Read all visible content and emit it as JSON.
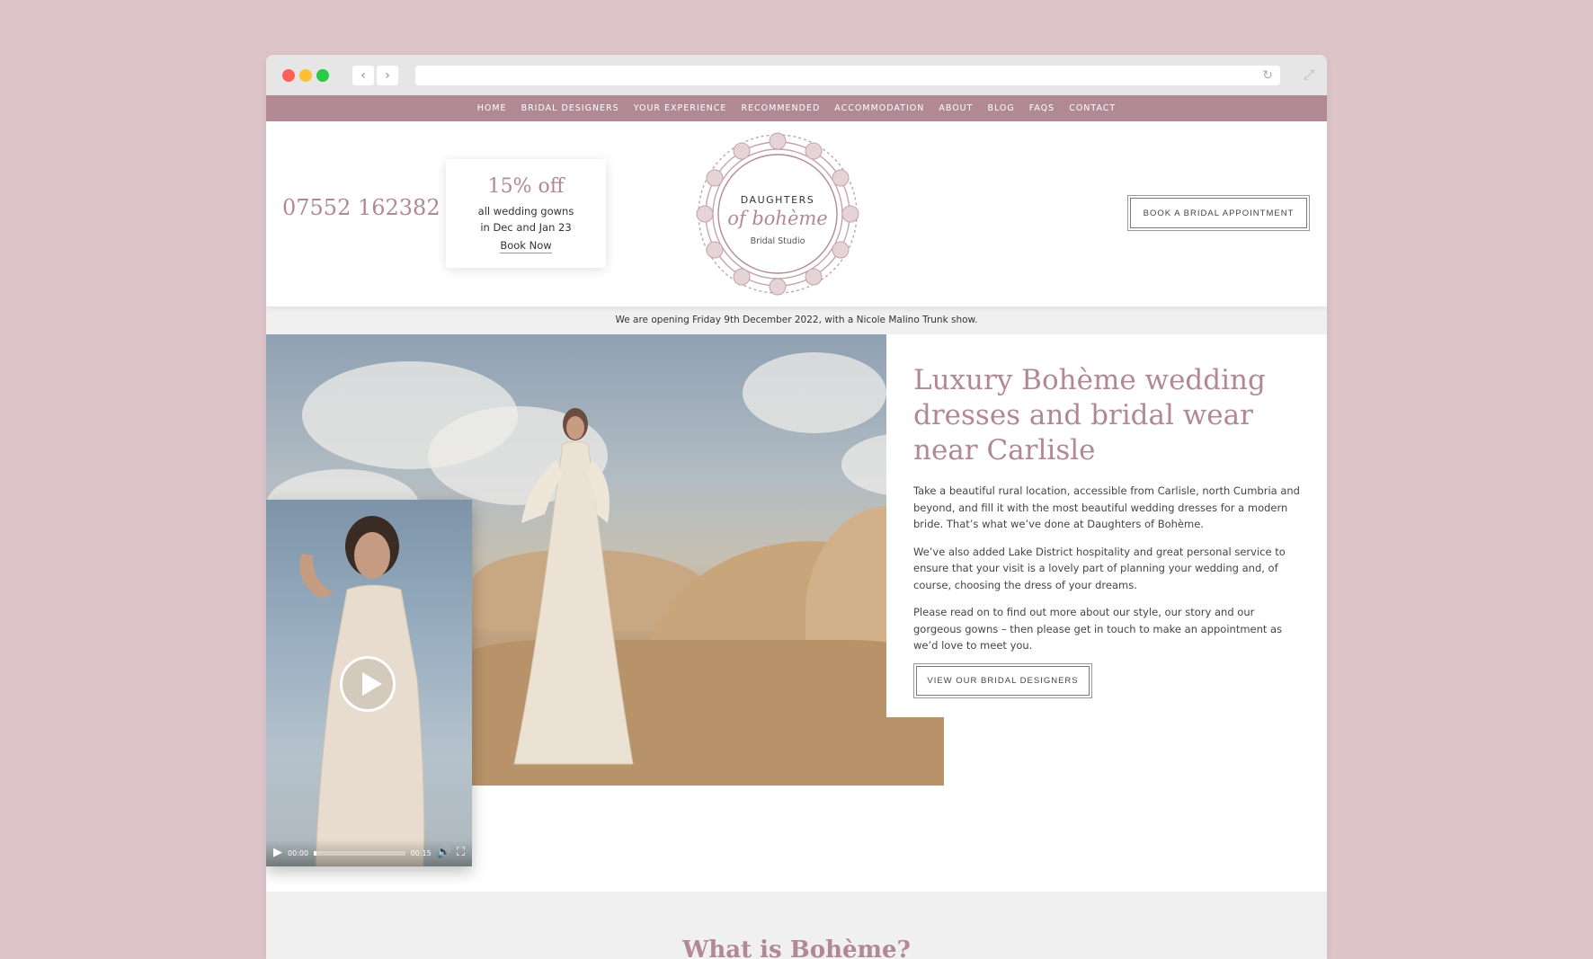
{
  "browser": {
    "back_icon": "chevron-left-icon",
    "forward_icon": "chevron-right-icon",
    "reload_icon": "reload-icon",
    "expand_icon": "expand-icon",
    "url": ""
  },
  "nav": {
    "items": [
      "HOME",
      "BRIDAL DESIGNERS",
      "YOUR EXPERIENCE",
      "RECOMMENDED",
      "ACCOMMODATION",
      "ABOUT",
      "BLOG",
      "FAQS",
      "CONTACT"
    ]
  },
  "header": {
    "phone": "07552 162382",
    "promo": {
      "title": "15% off",
      "line1": "all wedding gowns",
      "line2": "in Dec and Jan 23",
      "link": "Book Now"
    },
    "logo": {
      "line1": "DAUGHTERS",
      "line2": "of bohème",
      "line3": "Bridal Studio"
    },
    "cta": "BOOK A BRIDAL APPOINTMENT"
  },
  "announcement": "We are opening Friday 9th December 2022, with a Nicole Malino Trunk show.",
  "hero": {
    "headline": "Luxury Bohème wedding dresses and bridal wear near Carlisle",
    "paragraphs": [
      "Take a beautiful rural location, accessible from Carlisle, north Cumbria and beyond, and fill it with the most beautiful wedding dresses for a modern bride. That’s what we’ve done at Daughters of Bohème.",
      "We’ve also added Lake District hospitality and great personal service to ensure that your visit is a lovely part of planning your wedding and, of course, choosing the dress of your dreams.",
      "Please read on to find out more about our style, our story and our gorgeous gowns – then please get in touch to make an appointment as we’d love to meet you."
    ],
    "button": "VIEW OUR BRIDAL DESIGNERS"
  },
  "video": {
    "current_time": "00:00",
    "duration": "00:15",
    "progress": 0.03,
    "play_icon": "play-icon",
    "volume_icon": "volume-icon",
    "fullscreen_icon": "fullscreen-icon"
  },
  "section2": {
    "title": "What is Bohème?"
  },
  "colors": {
    "accent": "#b18993",
    "background": "#dcc4c9"
  }
}
